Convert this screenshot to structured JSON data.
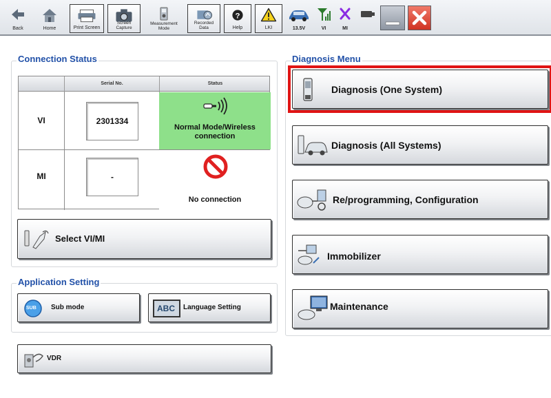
{
  "toolbar": {
    "buttons": [
      {
        "label": "Back",
        "icon": "back-arrow-icon"
      },
      {
        "label": "Home",
        "icon": "home-icon"
      },
      {
        "label": "Print Screen",
        "icon": "printer-icon"
      },
      {
        "label": "Screen Capture",
        "icon": "camera-icon"
      },
      {
        "label": "Measurement Mode",
        "icon": "meter-icon"
      },
      {
        "label": "Recorded Data",
        "icon": "recorded-data-icon"
      },
      {
        "label": "Help",
        "icon": "help-icon"
      },
      {
        "label": "LKI",
        "icon": "warning-icon"
      }
    ],
    "status": {
      "battery_voltage": "13.5V",
      "vi_label": "VI",
      "mi_label": "MI"
    }
  },
  "connection_status": {
    "title": "Connection Status",
    "columns": [
      "Serial No.",
      "Status"
    ],
    "rows": [
      {
        "label": "VI",
        "serial": "2301334",
        "status": "Normal Mode/Wireless connection"
      },
      {
        "label": "MI",
        "serial": "-",
        "status": "No connection"
      }
    ],
    "select_button": "Select VI/MI"
  },
  "application_setting": {
    "title": "Application Setting",
    "sub_mode": "Sub mode",
    "sub_mode_badge": "SUB",
    "language": "Language Setting",
    "language_badge": "ABC",
    "vdr": "VDR"
  },
  "diagnosis_menu": {
    "title": "Diagnosis Menu",
    "items": [
      {
        "label": "Diagnosis (One System)",
        "selected": true
      },
      {
        "label": "Diagnosis (All Systems)"
      },
      {
        "label": "Re/programming, Configuration"
      },
      {
        "label": "Immobilizer"
      },
      {
        "label": "Maintenance"
      }
    ]
  },
  "colors": {
    "accent_title": "#2251a8",
    "selection": "#e01414",
    "status_ok": "#8ee08a",
    "no_conn": "#e02020"
  }
}
